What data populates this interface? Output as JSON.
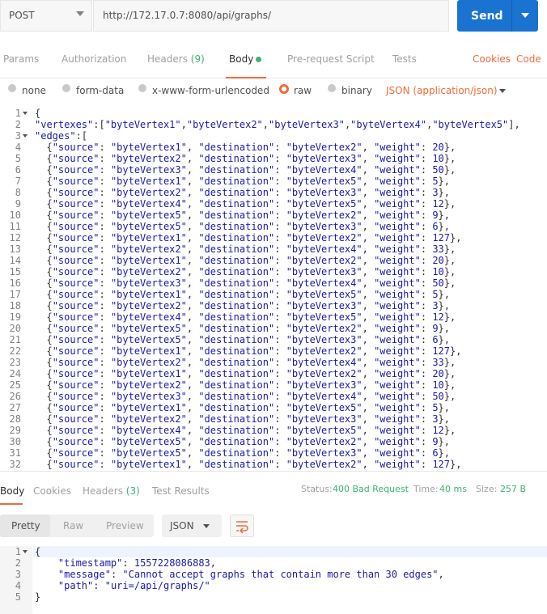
{
  "request": {
    "method": "POST",
    "url": "http://172.17.0.7:8080/api/graphs/",
    "send_label": "Send"
  },
  "request_tabs": {
    "params": "Params",
    "authorization": "Authorization",
    "headers": "Headers",
    "headers_count": "(9)",
    "body": "Body",
    "pre_request": "Pre-request Script",
    "tests": "Tests",
    "cookies": "Cookies",
    "code": "Code"
  },
  "body_types": {
    "none": "none",
    "form_data": "form-data",
    "urlencoded": "x-www-form-urlencoded",
    "raw": "raw",
    "binary": "binary",
    "content_type": "JSON (application/json)"
  },
  "request_body": {
    "line_numbers": [
      "1",
      "2",
      "3",
      "4",
      "5",
      "6",
      "7",
      "8",
      "9",
      "10",
      "11",
      "12",
      "13",
      "14",
      "15",
      "16",
      "17",
      "18",
      "19",
      "20",
      "21",
      "22",
      "23",
      "24",
      "25",
      "26",
      "27",
      "28",
      "29",
      "30",
      "31",
      "32"
    ],
    "lines": [
      "{",
      "\"vertexes\":[\"byteVertex1\",\"byteVertex2\",\"byteVertex3\",\"byteVertex4\",\"byteVertex5\"],",
      "\"edges\":[",
      "  {\"source\": \"byteVertex1\", \"destination\": \"byteVertex2\", \"weight\": 20},",
      "  {\"source\": \"byteVertex2\", \"destination\": \"byteVertex3\", \"weight\": 10},",
      "  {\"source\": \"byteVertex3\", \"destination\": \"byteVertex4\", \"weight\": 50},",
      "  {\"source\": \"byteVertex1\", \"destination\": \"byteVertex5\", \"weight\": 5},",
      "  {\"source\": \"byteVertex2\", \"destination\": \"byteVertex3\", \"weight\": 3},",
      "  {\"source\": \"byteVertex4\", \"destination\": \"byteVertex5\", \"weight\": 12},",
      "  {\"source\": \"byteVertex5\", \"destination\": \"byteVertex2\", \"weight\": 9},",
      "  {\"source\": \"byteVertex5\", \"destination\": \"byteVertex3\", \"weight\": 6},",
      "  {\"source\": \"byteVertex1\", \"destination\": \"byteVertex2\", \"weight\": 127},",
      "  {\"source\": \"byteVertex2\", \"destination\": \"byteVertex4\", \"weight\": 33},",
      "  {\"source\": \"byteVertex1\", \"destination\": \"byteVertex2\", \"weight\": 20},",
      "  {\"source\": \"byteVertex2\", \"destination\": \"byteVertex3\", \"weight\": 10},",
      "  {\"source\": \"byteVertex3\", \"destination\": \"byteVertex4\", \"weight\": 50},",
      "  {\"source\": \"byteVertex1\", \"destination\": \"byteVertex5\", \"weight\": 5},",
      "  {\"source\": \"byteVertex2\", \"destination\": \"byteVertex3\", \"weight\": 3},",
      "  {\"source\": \"byteVertex4\", \"destination\": \"byteVertex5\", \"weight\": 12},",
      "  {\"source\": \"byteVertex5\", \"destination\": \"byteVertex2\", \"weight\": 9},",
      "  {\"source\": \"byteVertex5\", \"destination\": \"byteVertex3\", \"weight\": 6},",
      "  {\"source\": \"byteVertex1\", \"destination\": \"byteVertex2\", \"weight\": 127},",
      "  {\"source\": \"byteVertex2\", \"destination\": \"byteVertex4\", \"weight\": 33},",
      "  {\"source\": \"byteVertex1\", \"destination\": \"byteVertex2\", \"weight\": 20},",
      "  {\"source\": \"byteVertex2\", \"destination\": \"byteVertex3\", \"weight\": 10},",
      "  {\"source\": \"byteVertex3\", \"destination\": \"byteVertex4\", \"weight\": 50},",
      "  {\"source\": \"byteVertex1\", \"destination\": \"byteVertex5\", \"weight\": 5},",
      "  {\"source\": \"byteVertex2\", \"destination\": \"byteVertex3\", \"weight\": 3},",
      "  {\"source\": \"byteVertex4\", \"destination\": \"byteVertex5\", \"weight\": 12},",
      "  {\"source\": \"byteVertex5\", \"destination\": \"byteVertex2\", \"weight\": 9},",
      "  {\"source\": \"byteVertex5\", \"destination\": \"byteVertex3\", \"weight\": 6},",
      "  {\"source\": \"byteVertex1\", \"destination\": \"byteVertex2\", \"weight\": 127},"
    ]
  },
  "response_tabs": {
    "body": "Body",
    "cookies": "Cookies",
    "headers": "Headers",
    "headers_count": "(3)",
    "test_results": "Test Results"
  },
  "response_status": {
    "status_label": "Status:",
    "status_value": "400 Bad Request",
    "time_label": "Time:",
    "time_value": "40 ms",
    "size_label": "Size:",
    "size_value": "257 B"
  },
  "response_toolbar": {
    "pretty": "Pretty",
    "raw": "Raw",
    "preview": "Preview",
    "format": "JSON"
  },
  "response_body": {
    "line_numbers": [
      "1",
      "2",
      "3",
      "4",
      "5"
    ],
    "lines": [
      "{",
      "    \"timestamp\": 1557228086883,",
      "    \"message\": \"Cannot accept graphs that contain more than 30 edges\",",
      "    \"path\": \"uri=/api/graphs/\"",
      "}"
    ]
  },
  "colors": {
    "accent": "#f26b3a",
    "send": "#1a73d1",
    "status_ok": "#3cb371"
  }
}
